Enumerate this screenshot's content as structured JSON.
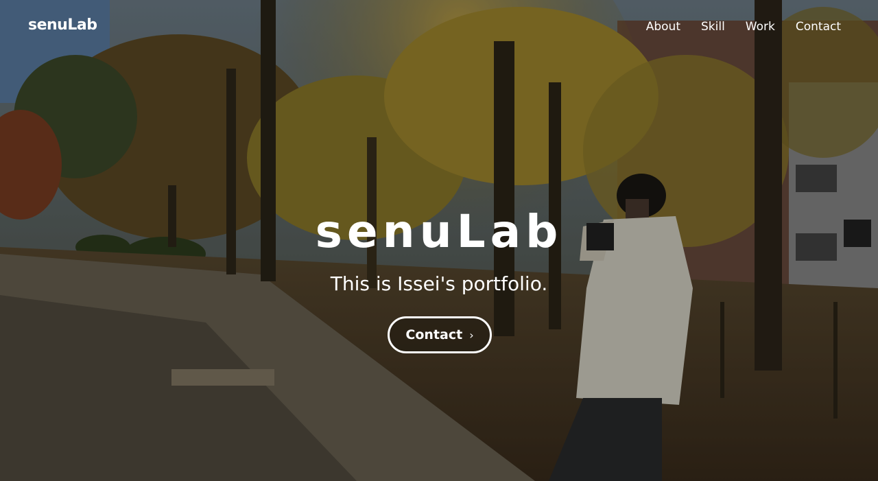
{
  "brand": {
    "logo": "senuLab"
  },
  "nav": {
    "items": [
      {
        "label": "About"
      },
      {
        "label": "Skill"
      },
      {
        "label": "Work"
      },
      {
        "label": "Contact"
      }
    ]
  },
  "hero": {
    "title": "senuLab",
    "subtitle": "This is Issei's portfolio.",
    "cta_label": "Contact",
    "cta_icon": "chevron-right-icon",
    "background_image": "autumn-park-photo"
  },
  "colors": {
    "text": "#ffffff",
    "overlay": "#000000"
  }
}
